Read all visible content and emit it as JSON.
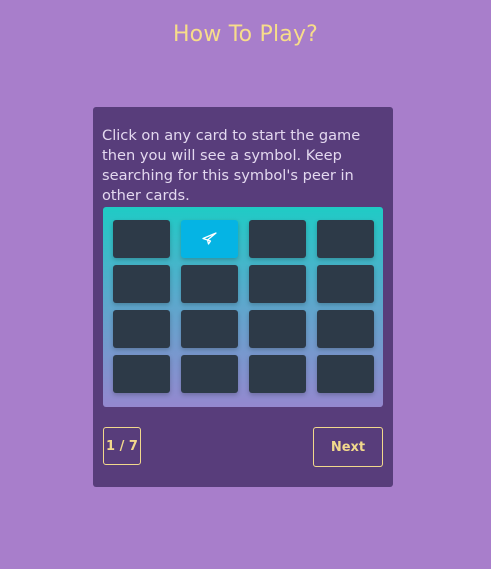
{
  "page": {
    "title": "How To Play?"
  },
  "tutorial": {
    "instructions": "Click on any card to start the game then you will see a symbol. Keep searching for this symbol's peer in other cards.",
    "step_current": "1",
    "step_total": "7",
    "step_label": "1 / 7",
    "next_label": "Next"
  },
  "board": {
    "rows": 4,
    "columns": 4,
    "cards": [
      {
        "state": "hidden"
      },
      {
        "state": "revealed",
        "symbol": "paper-plane-icon"
      },
      {
        "state": "hidden"
      },
      {
        "state": "hidden"
      },
      {
        "state": "hidden"
      },
      {
        "state": "hidden"
      },
      {
        "state": "hidden"
      },
      {
        "state": "hidden"
      },
      {
        "state": "hidden"
      },
      {
        "state": "hidden"
      },
      {
        "state": "hidden"
      },
      {
        "state": "hidden"
      },
      {
        "state": "hidden"
      },
      {
        "state": "hidden"
      },
      {
        "state": "hidden"
      },
      {
        "state": "hidden"
      }
    ]
  },
  "colors": {
    "page_background": "#a87ecb",
    "panel_background": "#583d7b",
    "accent": "#f2d98c",
    "card_hidden": "#2d3a48",
    "card_revealed": "#05b4e4"
  }
}
